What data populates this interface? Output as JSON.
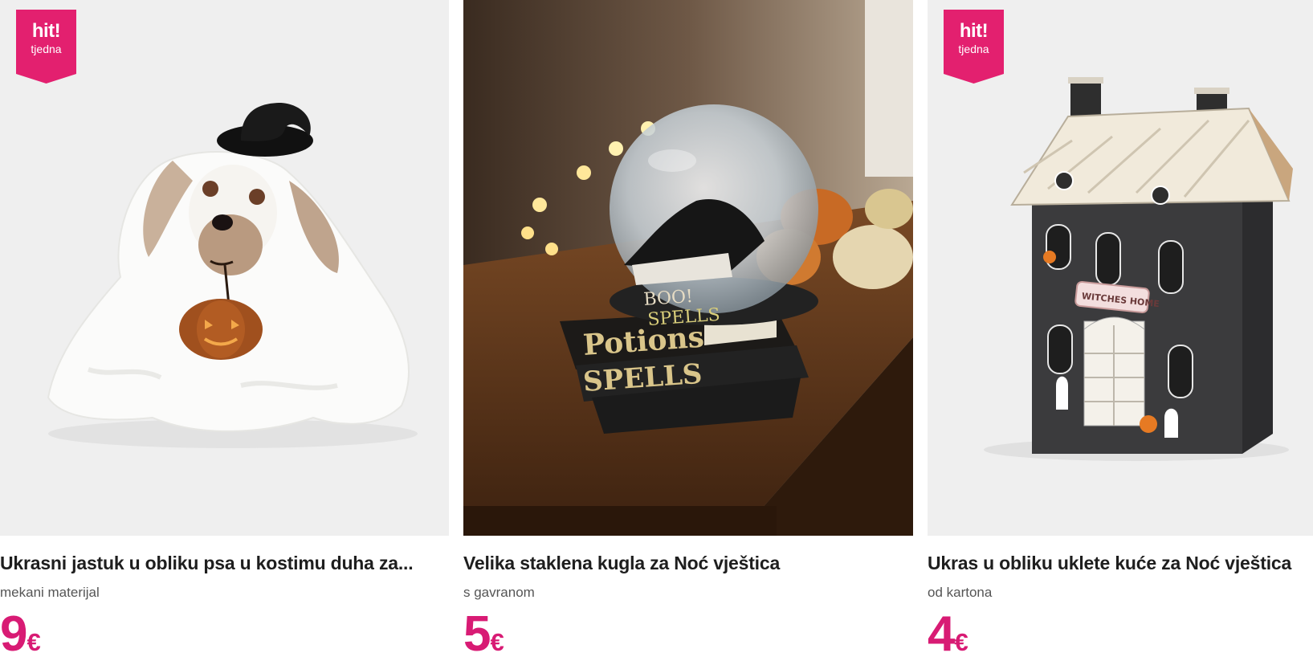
{
  "products": [
    {
      "title": "Ukrasni jastuk u obliku psa u kostimu duha za...",
      "subtitle": "mekani materijal",
      "price": "9",
      "currency": "€",
      "badge": {
        "top": "hit!",
        "bottom": "tjedna"
      },
      "image_subject": "ghost-dog-pillow"
    },
    {
      "title": "Velika staklena kugla za Noć vještica",
      "subtitle": "s gavranom",
      "price": "5",
      "currency": "€",
      "image_subject": "snow-globe-on-spell-books"
    },
    {
      "title": "Ukras u obliku uklete kuće za Noć vještica",
      "subtitle": "od kartona",
      "price": "4",
      "currency": "€",
      "badge": {
        "top": "hit!",
        "bottom": "tjedna"
      },
      "image_subject": "haunted-house-decoration"
    }
  ],
  "image_texts": {
    "books": [
      "Potions",
      "SPELLS",
      "BOO!",
      "SPELLS"
    ],
    "house_sign": "WITCHES HOME"
  },
  "colors": {
    "accent": "#d81b74",
    "badge": "#e3206f",
    "image_bg": "#efefef"
  }
}
